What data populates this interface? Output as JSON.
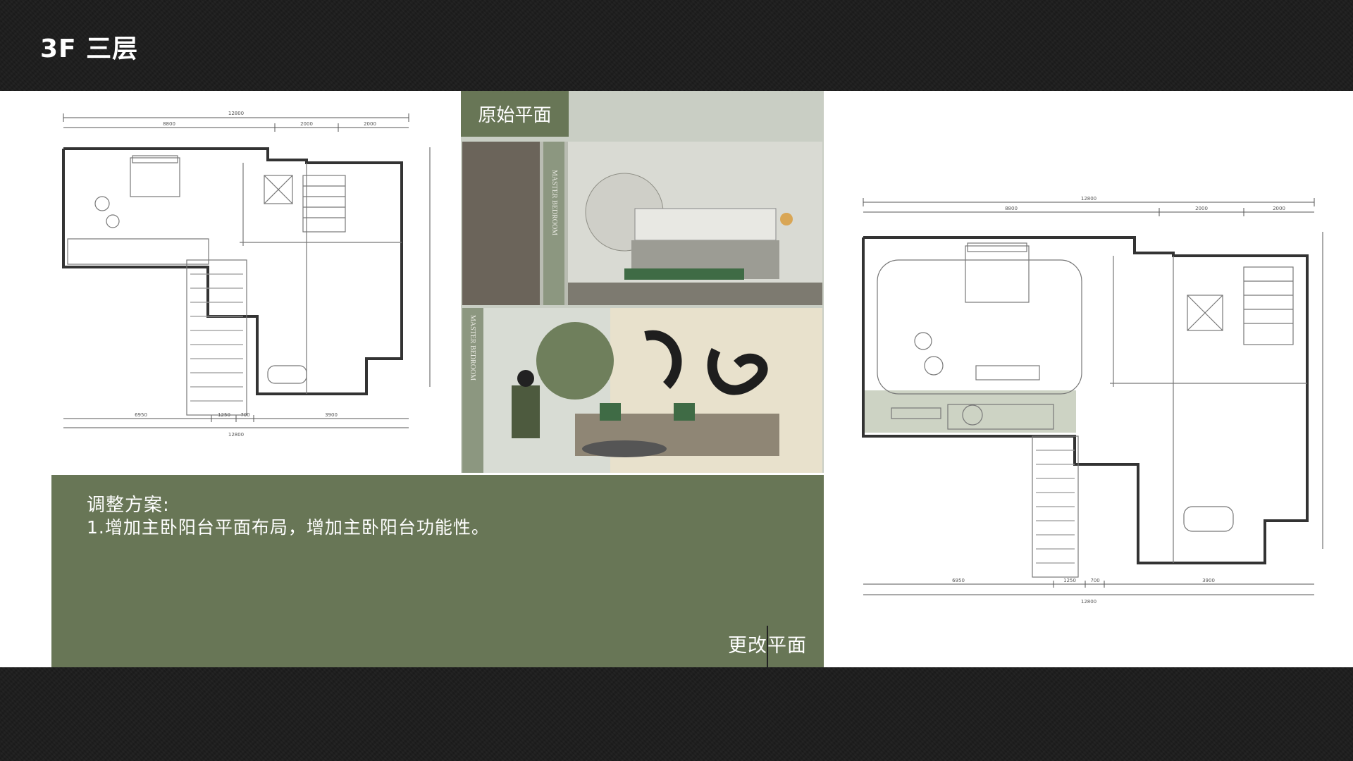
{
  "slide": {
    "title": "3F 三层"
  },
  "mood_board": {
    "label": "原始平面",
    "caption_top": "MASTER BEDROOM",
    "caption_bottom": "MASTER BEDROOM"
  },
  "adjustment": {
    "title": "调整方案:",
    "items": [
      "1.增加主卧阳台平面布局，增加主卧阳台功能性。"
    ],
    "changed_label": "更改平面"
  },
  "plan_original": {
    "dims_top": [
      "12800",
      "8800",
      "2000",
      "2000"
    ],
    "dims_bottom": [
      "6950",
      "1250",
      "700",
      "3900",
      "12800"
    ]
  },
  "plan_modified": {
    "dims_top": [
      "12800",
      "8800",
      "2000",
      "2000"
    ],
    "dims_bottom": [
      "6950",
      "1250",
      "700",
      "3900",
      "12800"
    ]
  },
  "colors": {
    "accent_green": "#687656",
    "panel_gray": "#c9cec4",
    "background": "#1c1c1c"
  }
}
